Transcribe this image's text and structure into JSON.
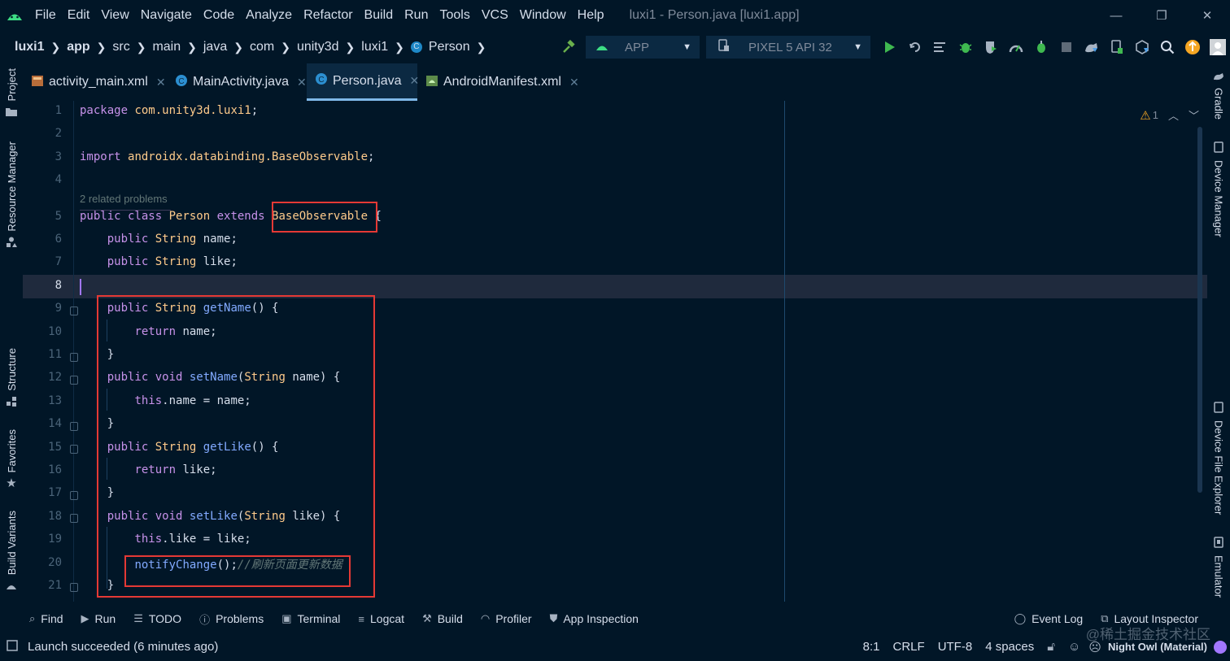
{
  "menubar": {
    "items": [
      "File",
      "Edit",
      "View",
      "Navigate",
      "Code",
      "Analyze",
      "Refactor",
      "Build",
      "Run",
      "Tools",
      "VCS",
      "Window",
      "Help"
    ],
    "window_title": "luxi1 - Person.java [luxi1.app]"
  },
  "breadcrumb": [
    "luxi1",
    "app",
    "src",
    "main",
    "java",
    "com",
    "unity3d",
    "luxi1",
    "Person"
  ],
  "toolbar": {
    "run_config": "APP",
    "device": "PIXEL 5 API 32"
  },
  "tabs": [
    {
      "label": "activity_main.xml",
      "icon": "xml-layout-icon"
    },
    {
      "label": "MainActivity.java",
      "icon": "java-class-icon"
    },
    {
      "label": "Person.java",
      "icon": "java-class-icon",
      "active": true
    },
    {
      "label": "AndroidManifest.xml",
      "icon": "android-manifest-icon"
    }
  ],
  "left_tools": [
    "Project",
    "Resource Manager",
    "Structure",
    "Favorites",
    "Build Variants"
  ],
  "right_tools": [
    "Gradle",
    "Device Manager",
    "Device File Explorer",
    "Emulator"
  ],
  "editor": {
    "warning_count": "1",
    "problems_hint": "2 related problems",
    "current_line": 8,
    "lines": [
      {
        "n": "1",
        "tokens": [
          [
            "kw",
            "package "
          ],
          [
            "ty",
            "com.unity3d.luxi1"
          ],
          [
            "vr",
            ";"
          ]
        ]
      },
      {
        "n": "2",
        "tokens": []
      },
      {
        "n": "3",
        "tokens": [
          [
            "kw",
            "import "
          ],
          [
            "ty",
            "androidx.databinding.BaseObservable"
          ],
          [
            "vr",
            ";"
          ]
        ]
      },
      {
        "n": "4",
        "tokens": []
      },
      {
        "n": "5",
        "tokens": [
          [
            "kw",
            "public class "
          ],
          [
            "ty",
            "Person "
          ],
          [
            "kw",
            "extends "
          ],
          [
            "ty",
            "BaseObservable"
          ],
          [
            "vr",
            " {"
          ]
        ]
      },
      {
        "n": "6",
        "tokens": [
          [
            "vr",
            "    "
          ],
          [
            "kw",
            "public "
          ],
          [
            "ty",
            "String "
          ],
          [
            "vr",
            "name;"
          ]
        ]
      },
      {
        "n": "7",
        "tokens": [
          [
            "vr",
            "    "
          ],
          [
            "kw",
            "public "
          ],
          [
            "ty",
            "String "
          ],
          [
            "vr",
            "like;"
          ]
        ]
      },
      {
        "n": "8",
        "tokens": []
      },
      {
        "n": "9",
        "tokens": [
          [
            "vr",
            "    "
          ],
          [
            "kw",
            "public "
          ],
          [
            "ty",
            "String "
          ],
          [
            "fn",
            "getName"
          ],
          [
            "vr",
            "() {"
          ]
        ]
      },
      {
        "n": "10",
        "tokens": [
          [
            "vr",
            "        "
          ],
          [
            "kw",
            "return "
          ],
          [
            "vr",
            "name;"
          ]
        ]
      },
      {
        "n": "11",
        "tokens": [
          [
            "vr",
            "    }"
          ]
        ]
      },
      {
        "n": "12",
        "tokens": [
          [
            "vr",
            "    "
          ],
          [
            "kw",
            "public void "
          ],
          [
            "fn",
            "setName"
          ],
          [
            "vr",
            "("
          ],
          [
            "ty",
            "String "
          ],
          [
            "vr",
            "name) {"
          ]
        ]
      },
      {
        "n": "13",
        "tokens": [
          [
            "vr",
            "        "
          ],
          [
            "kw",
            "this"
          ],
          [
            "vr",
            ".name = name;"
          ]
        ]
      },
      {
        "n": "14",
        "tokens": [
          [
            "vr",
            "    }"
          ]
        ]
      },
      {
        "n": "15",
        "tokens": [
          [
            "vr",
            "    "
          ],
          [
            "kw",
            "public "
          ],
          [
            "ty",
            "String "
          ],
          [
            "fn",
            "getLike"
          ],
          [
            "vr",
            "() {"
          ]
        ]
      },
      {
        "n": "16",
        "tokens": [
          [
            "vr",
            "        "
          ],
          [
            "kw",
            "return "
          ],
          [
            "vr",
            "like;"
          ]
        ]
      },
      {
        "n": "17",
        "tokens": [
          [
            "vr",
            "    }"
          ]
        ]
      },
      {
        "n": "18",
        "tokens": [
          [
            "vr",
            "    "
          ],
          [
            "kw",
            "public void "
          ],
          [
            "fn",
            "setLike"
          ],
          [
            "vr",
            "("
          ],
          [
            "ty",
            "String "
          ],
          [
            "vr",
            "like) {"
          ]
        ]
      },
      {
        "n": "19",
        "tokens": [
          [
            "vr",
            "        "
          ],
          [
            "kw",
            "this"
          ],
          [
            "vr",
            ".like = like;"
          ]
        ]
      },
      {
        "n": "20",
        "tokens": [
          [
            "vr",
            "        "
          ],
          [
            "fn",
            "notifyChange"
          ],
          [
            "vr",
            "();"
          ],
          [
            "cm",
            "//刷新页面更新数据"
          ]
        ]
      },
      {
        "n": "21",
        "tokens": [
          [
            "vr",
            "    }"
          ]
        ]
      }
    ]
  },
  "tool_windows": {
    "left": [
      {
        "label": "Find",
        "icon": "search-icon"
      },
      {
        "label": "Run",
        "icon": "run-icon"
      },
      {
        "label": "TODO",
        "icon": "list-icon"
      },
      {
        "label": "Problems",
        "icon": "info-icon"
      },
      {
        "label": "Terminal",
        "icon": "terminal-icon"
      },
      {
        "label": "Logcat",
        "icon": "logcat-icon"
      },
      {
        "label": "Build",
        "icon": "hammer-icon"
      },
      {
        "label": "Profiler",
        "icon": "gauge-icon"
      },
      {
        "label": "App Inspection",
        "icon": "inspection-icon"
      }
    ],
    "right": [
      {
        "label": "Event Log",
        "icon": "bubble-icon"
      },
      {
        "label": "Layout Inspector",
        "icon": "layout-inspector-icon"
      }
    ]
  },
  "statusbar": {
    "message": "Launch succeeded (6 minutes ago)",
    "caret": "8:1",
    "line_sep": "CRLF",
    "encoding": "UTF-8",
    "indent": "4 spaces",
    "theme": "Night Owl (Material)",
    "watermark": "@稀土掘金技术社区"
  },
  "colors": {
    "background": "#011627",
    "keyword": "#c792ea",
    "type": "#ffcb8b",
    "function": "#82aaff",
    "comment": "#637777",
    "highlight_box": "#e53935",
    "run_green": "#3fb950"
  }
}
